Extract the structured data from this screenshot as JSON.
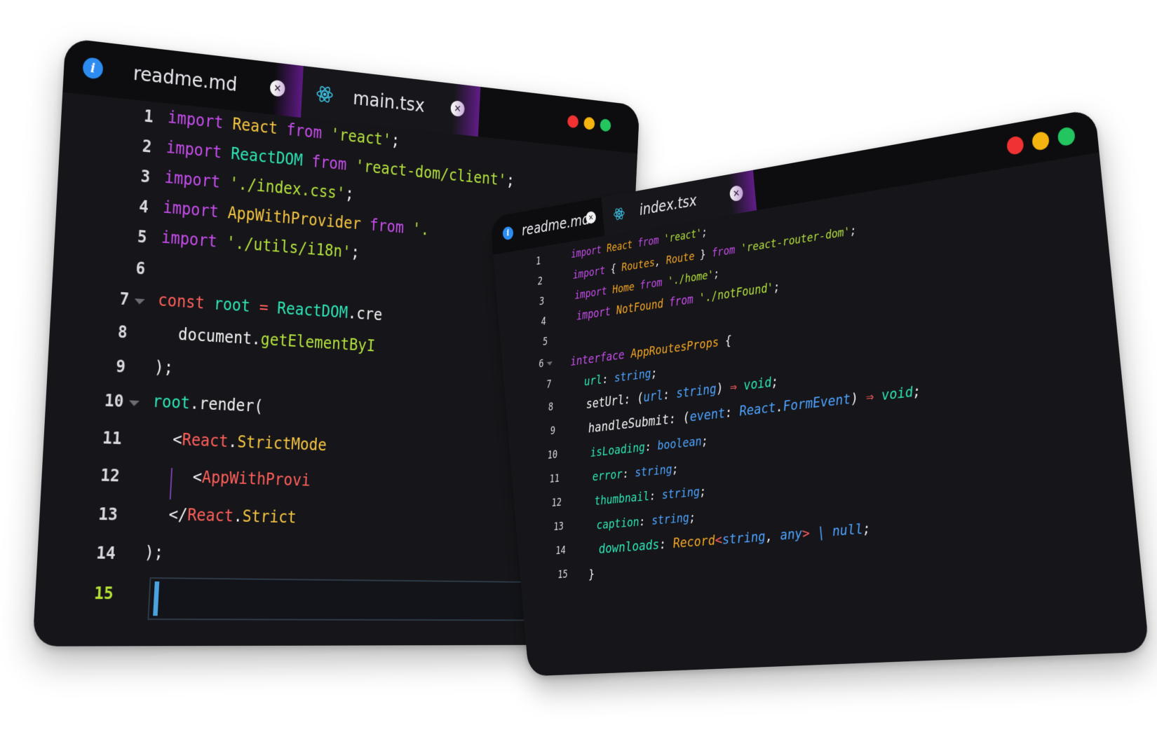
{
  "left_window": {
    "tabs": [
      {
        "label": "readme.md",
        "icon": "info-icon"
      },
      {
        "label": "main.tsx",
        "icon": "react-icon"
      }
    ],
    "window_controls": [
      "#f03232",
      "#f5b40f",
      "#22c55e"
    ],
    "line_numbers": [
      "1",
      "2",
      "3",
      "4",
      "5",
      "6",
      "7",
      "8",
      "9",
      "10",
      "11",
      "12",
      "13",
      "14",
      "15"
    ],
    "current_line": "15",
    "code": {
      "l1": [
        "import",
        "React",
        "from",
        "'react'",
        ";"
      ],
      "l2": [
        "import",
        "ReactDOM",
        "from",
        "'react-dom/client'",
        ";"
      ],
      "l3": [
        "import",
        "'./index.css'",
        ";"
      ],
      "l4": [
        "import",
        "AppWithProvider",
        "from",
        "'."
      ],
      "l5": [
        "import",
        "'./utils/i18n'",
        ";"
      ],
      "l7": [
        "const",
        "root",
        "=",
        "ReactDOM",
        ".cre"
      ],
      "l8": [
        "document",
        ".",
        "getElementByI"
      ],
      "l9": [
        ");"
      ],
      "l10": [
        "root",
        ".render("
      ],
      "l11": [
        "<",
        "React",
        ".",
        "StrictMode"
      ],
      "l12": [
        "<",
        "AppWithProvi"
      ],
      "l13": [
        "</",
        "React",
        ".",
        "Strict"
      ],
      "l14": [
        ");"
      ]
    }
  },
  "right_window": {
    "tabs": [
      {
        "label": "readme.md",
        "icon": "info-icon"
      },
      {
        "label": "index.tsx",
        "icon": "react-icon"
      }
    ],
    "window_controls": [
      "#f03232",
      "#f5b40f",
      "#22c55e"
    ],
    "line_numbers": [
      "1",
      "2",
      "3",
      "4",
      "5",
      "6",
      "7",
      "8",
      "9",
      "10",
      "11",
      "12",
      "13",
      "14",
      "15"
    ],
    "code": {
      "l1": [
        "import",
        "React",
        "from",
        "'react'",
        ";"
      ],
      "l2": [
        "import",
        "{ ",
        "Routes",
        ", ",
        "Route",
        " } ",
        "from",
        "'react-router-dom'",
        ";"
      ],
      "l3": [
        "import",
        "Home",
        "from",
        "'./home'",
        ";"
      ],
      "l4": [
        "import",
        "NotFound",
        "from",
        "'./notFound'",
        ";"
      ],
      "l6": [
        "interface",
        "AppRoutesProps",
        "{"
      ],
      "l7": [
        "url",
        ":",
        "string",
        ";"
      ],
      "l8": [
        "setUrl",
        ": (",
        "url",
        ":",
        "string",
        ")",
        "⇒",
        "void",
        ";"
      ],
      "l9": [
        "handleSubmit",
        ": (",
        "event",
        ":",
        "React",
        ".",
        "FormEvent",
        ")",
        "⇒",
        "void",
        ";"
      ],
      "l10": [
        "isLoading",
        ":",
        "boolean",
        ";"
      ],
      "l11": [
        "error",
        ":",
        "string",
        ";"
      ],
      "l12": [
        "thumbnail",
        ":",
        "string",
        ";"
      ],
      "l13": [
        "caption",
        ":",
        "string",
        ";"
      ],
      "l14": [
        "downloads",
        ":",
        "Record",
        "<",
        "string",
        ", ",
        "any",
        ">",
        " | ",
        "null",
        ";"
      ],
      "l15": [
        "}"
      ]
    }
  }
}
